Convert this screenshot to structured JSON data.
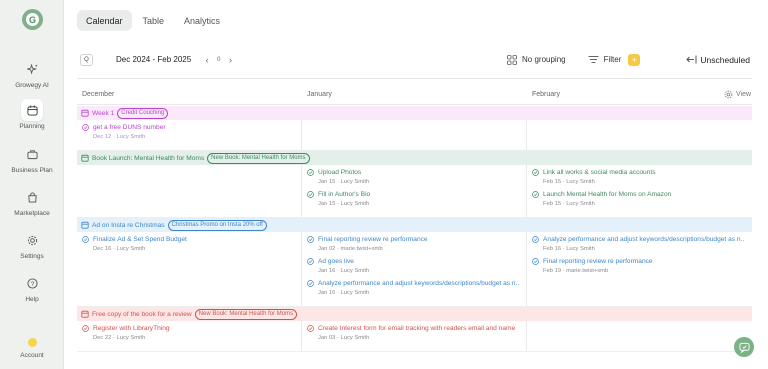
{
  "app": {
    "logo_letter": "G",
    "accent": "#7fb08a"
  },
  "sidebar": {
    "items": [
      {
        "label": "Growegy AI",
        "icon": "sparkle-icon"
      },
      {
        "label": "Planning",
        "icon": "calendar-icon",
        "active": true
      },
      {
        "label": "Business Plan",
        "icon": "briefcase-icon"
      },
      {
        "label": "Marketplace",
        "icon": "bag-icon"
      },
      {
        "label": "Settings",
        "icon": "gear-icon"
      },
      {
        "label": "Help",
        "icon": "help-icon"
      }
    ],
    "account_label": "Account"
  },
  "tabs": [
    {
      "label": "Calendar",
      "active": true
    },
    {
      "label": "Table"
    },
    {
      "label": "Analytics"
    }
  ],
  "toolbar": {
    "q_label": "Q",
    "date_range": "Dec 2024 - Feb 2025",
    "prev": "‹",
    "next": "›",
    "counter": "0",
    "grouping_label": "No grouping",
    "filter_label": "Filter",
    "add_label": "+",
    "unscheduled_label": "Unscheduled"
  },
  "columns": {
    "c1": "December",
    "c2": "January",
    "c3": "February",
    "view": "View"
  },
  "sections": [
    {
      "title": "Week 1",
      "tag": "Credit Couching",
      "color": "violet",
      "bg": "#fbe9fb",
      "cols": [
        [
          {
            "title": "get a free DUNS number",
            "meta": "Dec 12 · Lucy Smith"
          }
        ],
        [],
        []
      ]
    },
    {
      "title": "Book Launch: Mental Health for Moms",
      "tag": "New Book: Mental Health for Moms",
      "color": "green",
      "bg": "#e3f0ea",
      "cols": [
        [],
        [
          {
            "title": "Upload Photos",
            "meta": "Jan 15 · Lucy Smith"
          },
          {
            "title": "Fill in Author's Bio",
            "meta": "Jan 15 · Lucy Smith"
          }
        ],
        [
          {
            "title": "Link all works & social media accounts",
            "meta": "Feb 15 · Lucy Smith"
          },
          {
            "title": "Launch Mental Health for Moms on Amazon",
            "meta": "Feb 15 · Lucy Smith"
          }
        ]
      ]
    },
    {
      "title": "Ad on Insta re Christmas",
      "tag": "Christmas Promo on Insta 20% off",
      "color": "blue",
      "bg": "#e4f0fa",
      "cols": [
        [
          {
            "title": "Finalize Ad & Set Spend Budget",
            "meta": "Dec 16 · Lucy Smith"
          }
        ],
        [
          {
            "title": "Final reporting review re performance",
            "meta": "Jan 02 · marie.twist+smb"
          },
          {
            "title": "Ad goes live",
            "meta": "Jan 16 · Lucy Smith"
          },
          {
            "title": "Analyze performance and adjust keywords/descriptions/budget as n...",
            "meta": "Jan 16 · Lucy Smith"
          }
        ],
        [
          {
            "title": "Analyze performance and adjust keywords/descriptions/budget as n...",
            "meta": "Feb 16 · Lucy Smith"
          },
          {
            "title": "Final reporting review re performance",
            "meta": "Feb 19 · marie.twist+smb"
          }
        ]
      ]
    },
    {
      "title": "Free copy of the book for a review",
      "tag": "New Book: Mental Health for Moms",
      "color": "red",
      "bg": "#fde7e6",
      "cols": [
        [
          {
            "title": "Register with LibraryThing",
            "meta": "Dec 22 · Lucy Smith"
          }
        ],
        [
          {
            "title": "Create Interest form for email tracking with readers email and name",
            "meta": "Jan 03 · Lucy Smith"
          }
        ],
        []
      ]
    }
  ]
}
